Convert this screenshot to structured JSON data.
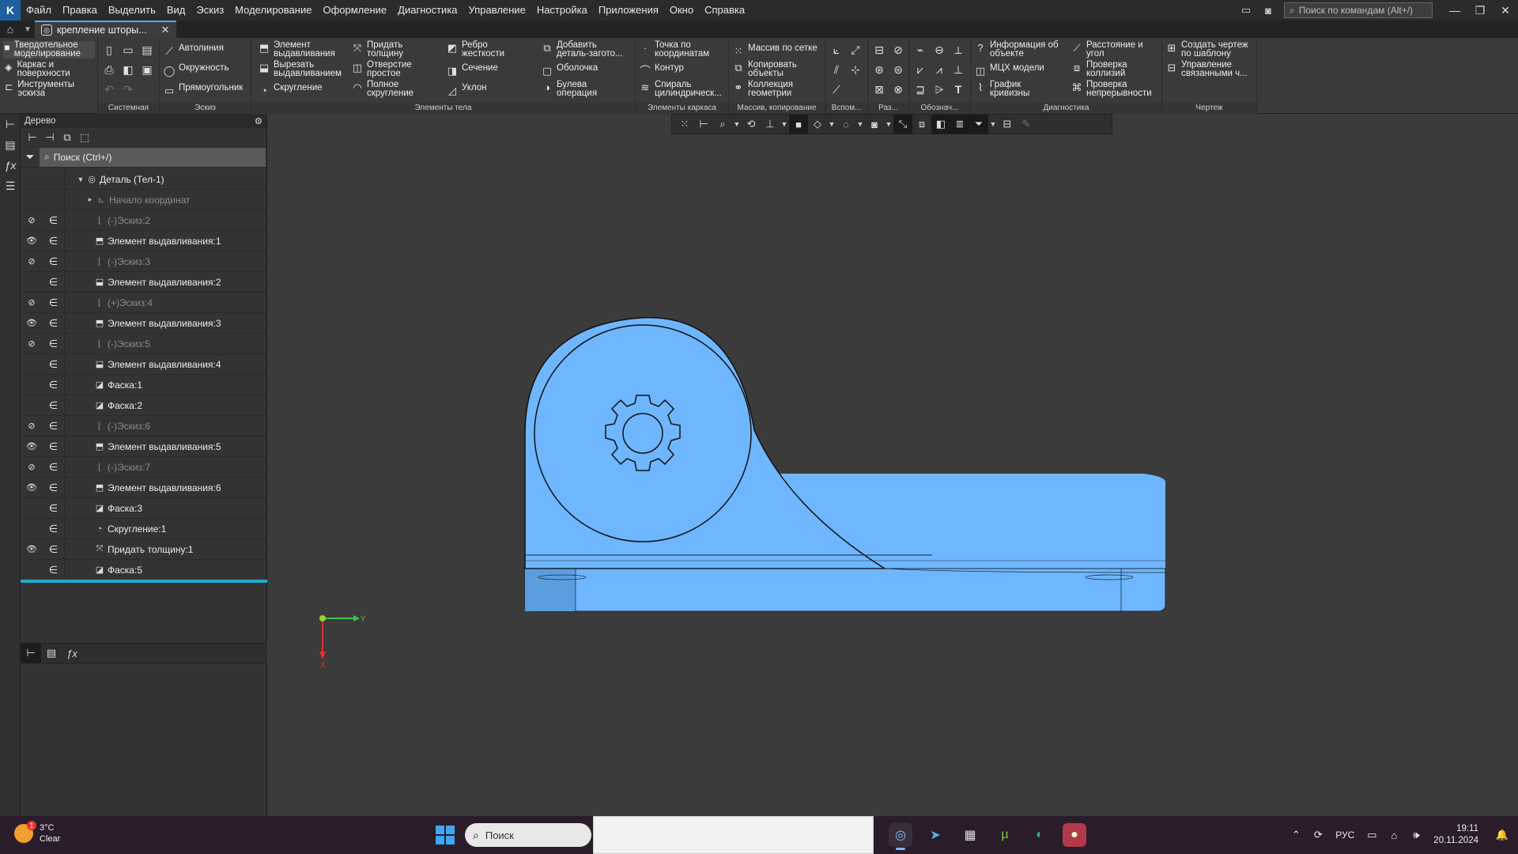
{
  "menubar": {
    "items": [
      "Файл",
      "Правка",
      "Выделить",
      "Вид",
      "Эскиз",
      "Моделирование",
      "Оформление",
      "Диагностика",
      "Управление",
      "Настройка",
      "Приложения",
      "Окно",
      "Справка"
    ],
    "search_placeholder": "Поиск по командам (Alt+/)"
  },
  "tabbar": {
    "doc_tab": "крепление шторы..."
  },
  "ribbon": {
    "modes": [
      "Твердотельное\nмоделирование",
      "Каркас и\nповерхности",
      "Инструменты\nэскиза"
    ],
    "group_labels": [
      "Системная",
      "Эскиз",
      "Элементы тела",
      "Элементы каркаса",
      "Массив, копирование",
      "Вспом...",
      "Раз...",
      "Обознач...",
      "Диагностика",
      "Чертеж"
    ],
    "sketch": [
      "Автолиния",
      "Окружность",
      "Прямоугольник"
    ],
    "body1": [
      "Элемент\nвыдавливания",
      "Вырезать\nвыдавливанием",
      "Скругление"
    ],
    "body2": [
      "Придать\nтолщину",
      "Отверстие\nпростое",
      "Полное\nскругление"
    ],
    "body3": [
      "Ребро\nжесткости",
      "Сечение",
      "Уклон"
    ],
    "body4": [
      "Добавить\nдеталь-загото...",
      "Оболочка",
      "Булева\nоперация"
    ],
    "frame": [
      "Точка по\nкоординатам",
      "Контур",
      "Спираль\nцилиндричеcк..."
    ],
    "array": [
      "Массив по сетке",
      "Копировать\nобъекты",
      "Коллекция\nгеометрии"
    ],
    "diag": [
      "Информация об\nобъекте",
      "МЦХ модели",
      "График\nкривизны"
    ],
    "diag2": [
      "Расстояние и\nугол",
      "Проверка\nколлизий",
      "Проверка\nнепрерывности"
    ],
    "drawing": [
      "Создать чертеж\nпо шаблону",
      "Управление\nсвязанными ч..."
    ]
  },
  "tree": {
    "title": "Дерево",
    "search_placeholder": "Поиск (Ctrl+/)",
    "root": "Деталь (Тел-1)",
    "rows": [
      {
        "vis": "",
        "inc": "",
        "icon": "origin-icon",
        "label": "Начало координат",
        "dim": true
      },
      {
        "vis": "hidden",
        "inc": "∈",
        "icon": "sketch-icon",
        "label": "(-)Эскиз:2",
        "dim": true
      },
      {
        "vis": "shown",
        "inc": "∈",
        "icon": "extrude-icon",
        "label": "Элемент выдавливания:1",
        "dim": false
      },
      {
        "vis": "hidden",
        "inc": "∈",
        "icon": "sketch-icon",
        "label": "(-)Эскиз:3",
        "dim": true
      },
      {
        "vis": "",
        "inc": "∈",
        "icon": "cut-icon",
        "label": "Элемент выдавливания:2",
        "dim": false
      },
      {
        "vis": "hidden",
        "inc": "∈",
        "icon": "sketch-icon",
        "label": "(+)Эскиз:4",
        "dim": true
      },
      {
        "vis": "shown",
        "inc": "∈",
        "icon": "extrude-icon",
        "label": "Элемент выдавливания:3",
        "dim": false
      },
      {
        "vis": "hidden",
        "inc": "∈",
        "icon": "sketch-icon",
        "label": "(-)Эскиз:5",
        "dim": true
      },
      {
        "vis": "",
        "inc": "∈",
        "icon": "cut-icon",
        "label": "Элемент выдавливания:4",
        "dim": false
      },
      {
        "vis": "",
        "inc": "∈",
        "icon": "chamfer-icon",
        "label": "Фаска:1",
        "dim": false
      },
      {
        "vis": "",
        "inc": "∈",
        "icon": "chamfer-icon",
        "label": "Фаска:2",
        "dim": false
      },
      {
        "vis": "hidden",
        "inc": "∈",
        "icon": "sketch-icon",
        "label": "(-)Эскиз:6",
        "dim": true
      },
      {
        "vis": "shown",
        "inc": "∈",
        "icon": "extrude-icon",
        "label": "Элемент выдавливания:5",
        "dim": false
      },
      {
        "vis": "hidden",
        "inc": "∈",
        "icon": "sketch-icon",
        "label": "(-)Эскиз:7",
        "dim": true
      },
      {
        "vis": "shown",
        "inc": "∈",
        "icon": "extrude-icon",
        "label": "Элемент выдавливания:6",
        "dim": false
      },
      {
        "vis": "",
        "inc": "∈",
        "icon": "chamfer-icon",
        "label": "Фаска:3",
        "dim": false
      },
      {
        "vis": "",
        "inc": "∈",
        "icon": "fillet-icon",
        "label": "Скругление:1",
        "dim": false
      },
      {
        "vis": "shown",
        "inc": "∈",
        "icon": "thicken-icon",
        "label": "Придать толщину:1",
        "dim": false
      },
      {
        "vis": "",
        "inc": "∈",
        "icon": "chamfer-icon",
        "label": "Фаска:5",
        "dim": false
      }
    ]
  },
  "viewport": {
    "model_color": "#6eb6ff",
    "axis_y": "Y",
    "axis_x": "X"
  },
  "taskbar": {
    "weather_temp": "3°C",
    "weather_desc": "Clear",
    "weather_badge": "1",
    "search_label": "Поиск",
    "lang": "РУС",
    "time": "19:11",
    "date": "20.11.2024"
  }
}
